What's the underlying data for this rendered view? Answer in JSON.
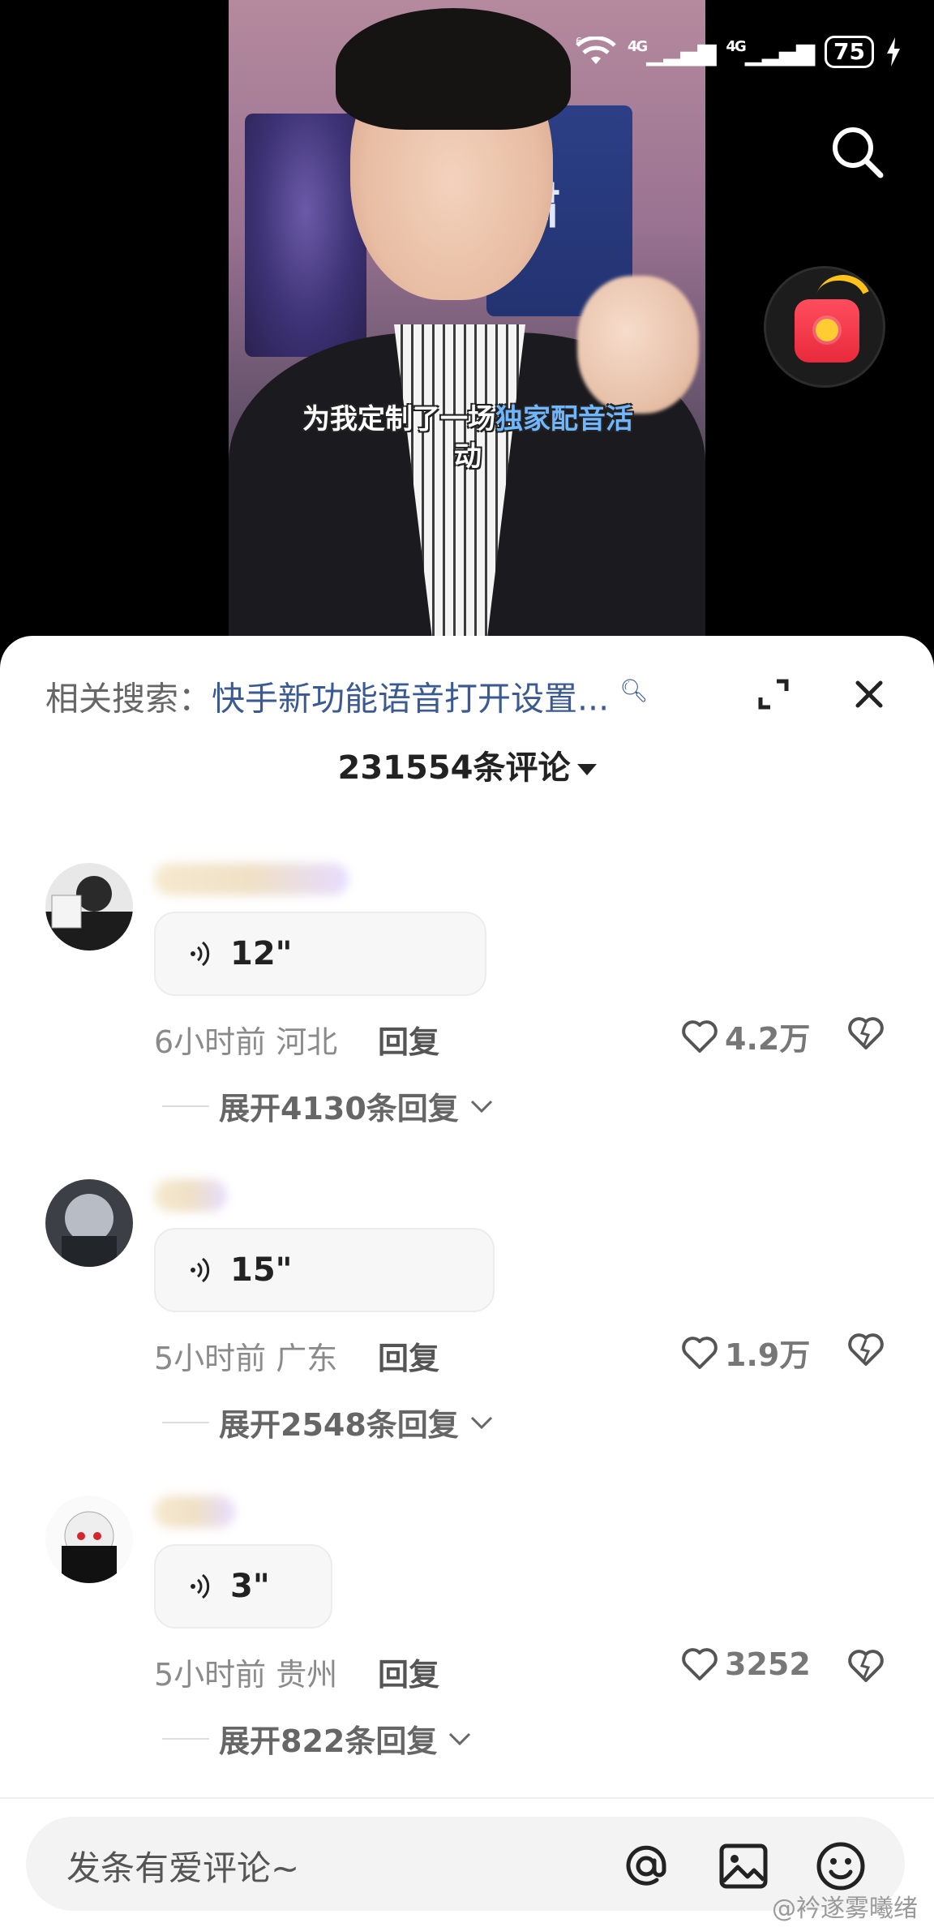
{
  "status_bar": {
    "signal_wifi": "6",
    "signal_1": "4G",
    "signal_2": "4G",
    "battery": "75"
  },
  "video": {
    "subtitle_line1_a": "为我定制了一场",
    "subtitle_line1_b": "独家配音活",
    "subtitle_line2": "动",
    "poster_text": "肃"
  },
  "sheet": {
    "related_label": "相关搜索：",
    "related_query": "快手新功能语音打开设置...",
    "comment_count": "231554条评论"
  },
  "comments": [
    {
      "duration": "12\"",
      "time_location": "6小时前 河北",
      "reply": "回复",
      "likes": "4.2万",
      "expand": "展开4130条回复"
    },
    {
      "duration": "15\"",
      "time_location": "5小时前 广东",
      "reply": "回复",
      "likes": "1.9万",
      "expand": "展开2548条回复"
    },
    {
      "duration": "3\"",
      "time_location": "5小时前 贵州",
      "reply": "回复",
      "likes": "3252",
      "expand": "展开822条回复"
    }
  ],
  "input": {
    "placeholder": "发条有爱评论~"
  },
  "watermark": "@衿遂雾曦绪",
  "icons": {
    "search": "search-icon",
    "redpacket": "red-packet-icon",
    "expand": "expand-icon",
    "close": "close-icon",
    "voice": "voice-wave-icon",
    "like": "heart-icon",
    "dislike": "broken-heart-icon",
    "chevron": "chevron-down-icon",
    "at": "at-icon",
    "image": "image-icon",
    "emoji": "emoji-icon"
  },
  "colors": {
    "accent_query": "#3a5a91",
    "subtitle_highlight": "#6fb6ff",
    "redpacket": "#e82a3c",
    "redpacket_ring": "#ffc21a"
  }
}
